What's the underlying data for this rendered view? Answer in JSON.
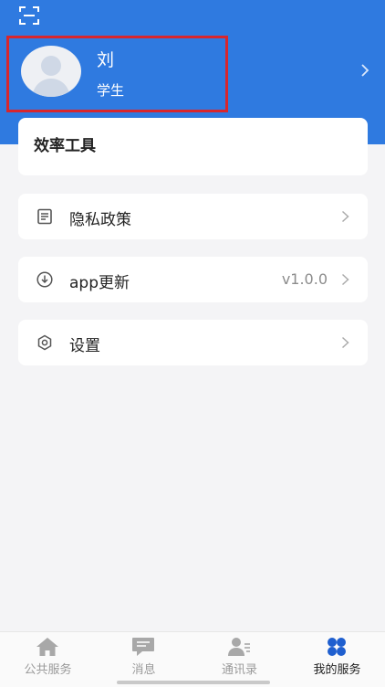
{
  "profile": {
    "name": "刘",
    "role": "学生"
  },
  "tools": {
    "title": "效率工具"
  },
  "menu": [
    {
      "icon": "document-icon",
      "label": "隐私政策",
      "value": ""
    },
    {
      "icon": "download-icon",
      "label": "app更新",
      "value": "v1.0.0"
    },
    {
      "icon": "gear-icon",
      "label": "设置",
      "value": ""
    }
  ],
  "tabs": [
    {
      "icon": "home-icon",
      "label": "公共服务",
      "active": false
    },
    {
      "icon": "message-icon",
      "label": "消息",
      "active": false
    },
    {
      "icon": "contacts-icon",
      "label": "通讯录",
      "active": false
    },
    {
      "icon": "clover-icon",
      "label": "我的服务",
      "active": true
    }
  ],
  "colors": {
    "header": "#2f7ae0",
    "highlight_border": "#d8262d",
    "active_tab": "#1f5fcf"
  }
}
